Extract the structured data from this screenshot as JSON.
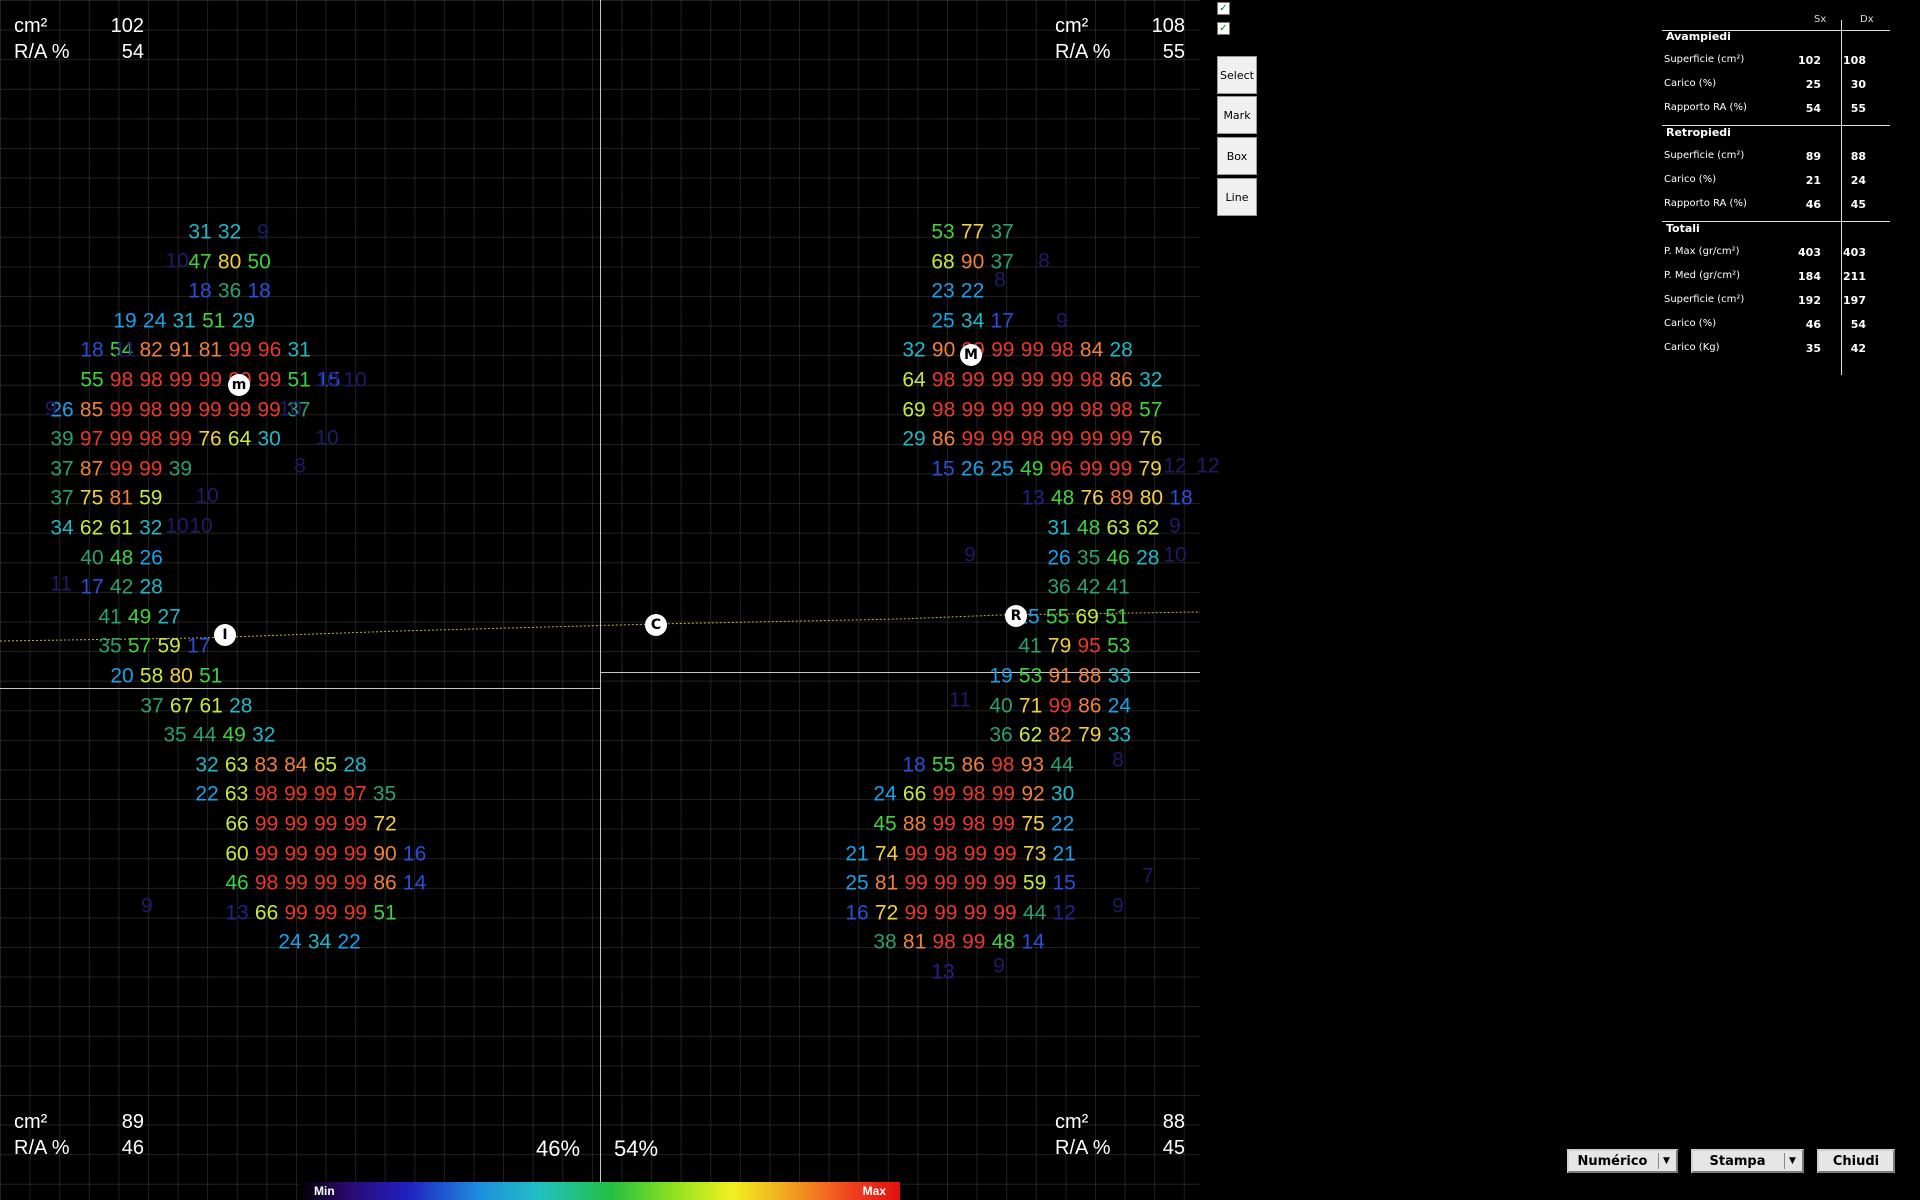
{
  "corner_info": {
    "top_left": {
      "area_label": "cm²",
      "area": "102",
      "ra_label": "R/A %",
      "ra": "54"
    },
    "top_right": {
      "area_label": "cm²",
      "area": "108",
      "ra_label": "R/A %",
      "ra": "55"
    },
    "bottom_left": {
      "area_label": "cm²",
      "area": "89",
      "ra_label": "R/A %",
      "ra": "46"
    },
    "bottom_right": {
      "area_label": "cm²",
      "area": "88",
      "ra_label": "R/A %",
      "ra": "45"
    }
  },
  "load_percent": {
    "left": "46%",
    "right": "54%"
  },
  "markers": {
    "m": "m",
    "M": "M",
    "I": "I",
    "C": "C",
    "R": "R"
  },
  "scale": {
    "min": "Min",
    "max": "Max"
  },
  "tools": {
    "select": "Select",
    "mark": "Mark",
    "box": "Box",
    "line": "Line"
  },
  "checkboxes": [
    true,
    true
  ],
  "stats": {
    "col_sx": "Sx",
    "col_dx": "Dx",
    "sections": [
      {
        "title": "Avampiedi",
        "rows": [
          {
            "label": "Superficie (cm²)",
            "sx": "102",
            "dx": "108"
          },
          {
            "label": "Carico (%)",
            "sx": "25",
            "dx": "30"
          },
          {
            "label": "Rapporto RA (%)",
            "sx": "54",
            "dx": "55"
          }
        ]
      },
      {
        "title": "Retropiedi",
        "rows": [
          {
            "label": "Superficie (cm²)",
            "sx": "89",
            "dx": "88"
          },
          {
            "label": "Carico (%)",
            "sx": "21",
            "dx": "24"
          },
          {
            "label": "Rapporto RA (%)",
            "sx": "46",
            "dx": "45"
          }
        ]
      },
      {
        "title": "Totali",
        "rows": [
          {
            "label": "P. Max (gr/cm²)",
            "sx": "403",
            "dx": "403"
          },
          {
            "label": "P. Med (gr/cm²)",
            "sx": "184",
            "dx": "211"
          },
          {
            "label": "Superficie (cm²)",
            "sx": "192",
            "dx": "197"
          },
          {
            "label": "Carico (%)",
            "sx": "46",
            "dx": "54"
          },
          {
            "label": "Carico (Kg)",
            "sx": "35",
            "dx": "42"
          }
        ]
      }
    ]
  },
  "buttons": {
    "mode": "Numérico",
    "print": "Stampa",
    "close": "Chiudi"
  },
  "pressure_map": {
    "left_foot": [
      [
        "31 32"
      ],
      [
        "47 80 50"
      ],
      [
        "18 36 18"
      ],
      [
        "19 24 31 51 29"
      ],
      [
        "18 54 82 91 81 99 96 31"
      ],
      [
        "55 98 98 99 99 99 99 51 15"
      ],
      [
        "26 85 99 98 99 99 99 99 37"
      ],
      [
        "39 97 99 98 99 76 64 30"
      ],
      [
        "37 87 99 99 39"
      ],
      [
        "37 75 81 59"
      ],
      [
        "34 62 61 32"
      ],
      [
        "40 48 26"
      ],
      [
        "17 42 28"
      ],
      [
        "41 49 27"
      ],
      [
        "35 57 59 17"
      ],
      [
        "20 58 80 51"
      ],
      [
        "37 67 61 28"
      ],
      [
        "35 44 49 32"
      ],
      [
        "32 63 83 84 65 28"
      ],
      [
        "22 63 98 99 99 97 35"
      ],
      [
        "66 99 99 99 99 72"
      ],
      [
        "60 99 99 99 99 90 16"
      ],
      [
        "46 98 99 99 99 86 14"
      ],
      [
        "13 66 99 99 99 51"
      ],
      [
        "24 34 22"
      ]
    ],
    "right_foot": [
      [
        "53 77 37"
      ],
      [
        "68 90 37"
      ],
      [
        "23 22"
      ],
      [
        "25 34 17"
      ],
      [
        "32 90 99 99 99 98 84 28"
      ],
      [
        "64 98 99 99 99 99 98 86 32"
      ],
      [
        "69 98 99 99 99 99 98 98 57"
      ],
      [
        "29 86 99 99 98 99 99 99 76"
      ],
      [
        "15 26 25 49 96 99 99 79"
      ],
      [
        "13 48 76 89 80 18"
      ],
      [
        "31 48 63 62"
      ],
      [
        "26 35 46 28"
      ],
      [
        "36 42 41"
      ],
      [
        "25 55 69 51"
      ],
      [
        "41 79 95 53"
      ],
      [
        "19 53 91 88 33"
      ],
      [
        "40 71 99 86 24"
      ],
      [
        "36 62 82 79 33"
      ],
      [
        "18 55 86 98 93 44"
      ],
      [
        "24 66 99 98 99 92 30"
      ],
      [
        "45 88 99 98 99 75 22"
      ],
      [
        "21 74 99 98 99 99 73 21"
      ],
      [
        "25 81 99 99 99 99 59 15"
      ],
      [
        "16 72 99 99 99 99 44 12"
      ],
      [
        "38 81 98 99 48 14"
      ],
      [
        "13"
      ]
    ],
    "faint_cells": [
      "9",
      "10",
      "11",
      "10",
      "10",
      "10",
      "9",
      "10",
      "8",
      "12",
      "10",
      "11",
      "10",
      "9",
      "10",
      "12",
      "10",
      "9",
      "8",
      "8",
      "9",
      "11",
      "9",
      "8",
      "7",
      "9",
      "9"
    ]
  }
}
